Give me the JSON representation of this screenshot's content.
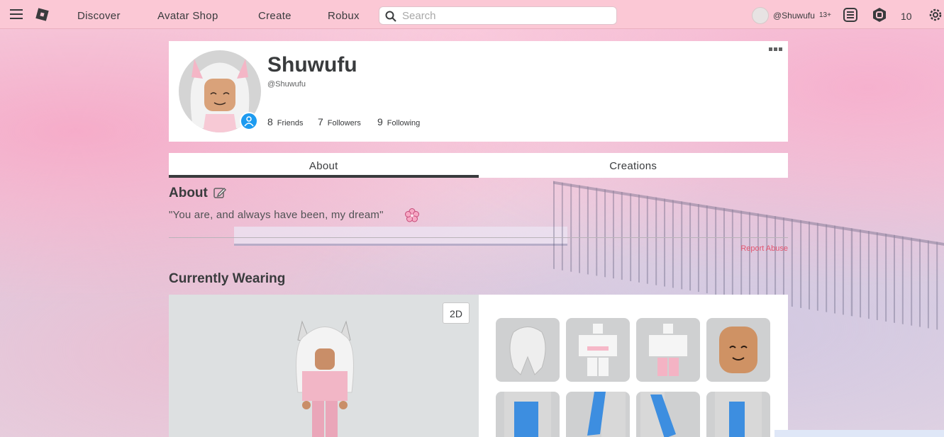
{
  "nav": {
    "links": [
      "Discover",
      "Avatar Shop",
      "Create",
      "Robux"
    ],
    "search_placeholder": "Search",
    "username": "@Shuwufu",
    "age_badge": "13+",
    "robux": "10"
  },
  "profile": {
    "display_name": "Shuwufu",
    "username": "@Shuwufu",
    "friends_count": "8",
    "friends_label": "Friends",
    "followers_count": "7",
    "followers_label": "Followers",
    "following_count": "9",
    "following_label": "Following"
  },
  "tabs": [
    "About",
    "Creations"
  ],
  "about": {
    "title": "About",
    "description": "\"You are, and always have been, my dream\"",
    "report_label": "Report Abuse"
  },
  "wearing": {
    "title": "Currently Wearing",
    "toggle_label": "2D",
    "items": [
      "hair",
      "shirt",
      "pants",
      "face",
      "arm-accessory",
      "arm-accessory",
      "arm-accessory",
      "arm-accessory"
    ]
  },
  "colors": {
    "navbar": "#fbc8d5",
    "text": "#393b3d",
    "report": "#e2546e",
    "online": "#1d9bf0"
  }
}
